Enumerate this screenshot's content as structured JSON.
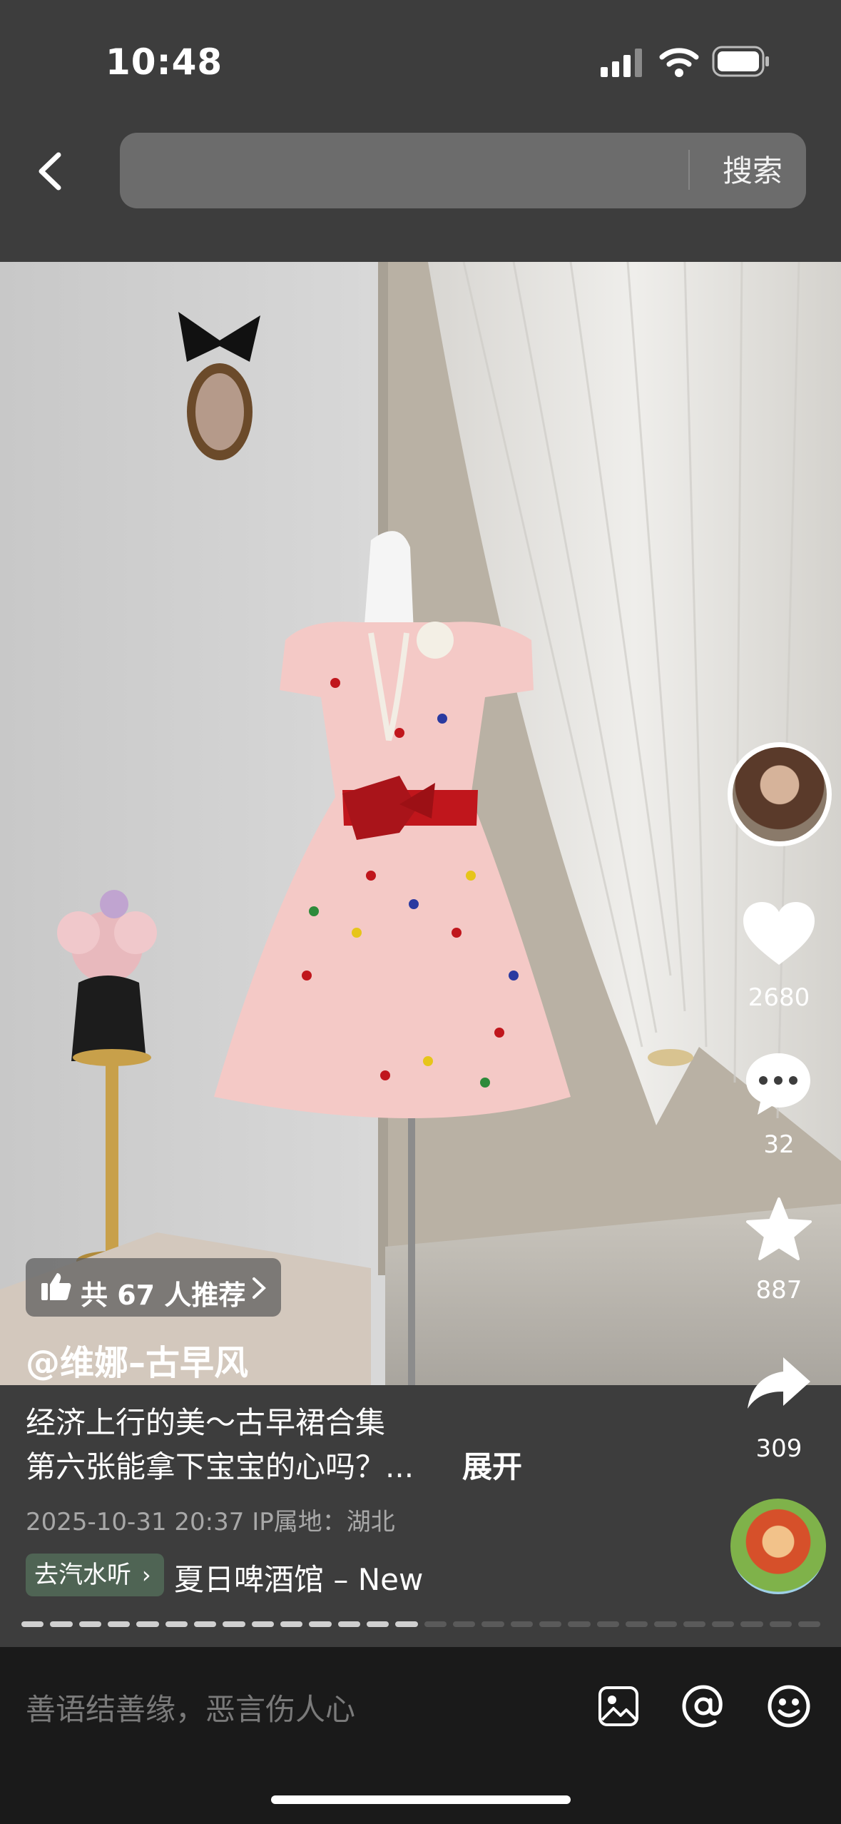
{
  "status_bar": {
    "time": "10:48"
  },
  "header": {
    "search_button": "搜索",
    "search_placeholder": ""
  },
  "actions": {
    "likes": "2680",
    "comments": "32",
    "favorites": "887",
    "shares": "309"
  },
  "post": {
    "recommend": "共 67 人推荐",
    "author": "@维娜–古早风",
    "desc_line1": "经济上行的美～古早裙合集",
    "desc_line2": "第六张能拿下宝宝的心吗？...",
    "expand": "展开",
    "date_location": "2025-10-31 20:37  IP属地：湖北",
    "music_tag": "去汽水听",
    "music_title": "夏日啤酒馆 – New",
    "progress": {
      "total": 28,
      "current": 14
    }
  },
  "comment_bar": {
    "placeholder": "善语结善缘，恶言伤人心"
  },
  "colors": {
    "accent_green": "#4f6454",
    "comment_bg": "#1a1a1a"
  },
  "icons": [
    "back-icon",
    "signal-icon",
    "wifi-icon",
    "battery-icon",
    "heart-icon",
    "comment-icon",
    "star-icon",
    "share-icon",
    "thumbs-up-icon",
    "image-icon",
    "at-icon",
    "emoji-icon",
    "chevron-right-icon"
  ]
}
